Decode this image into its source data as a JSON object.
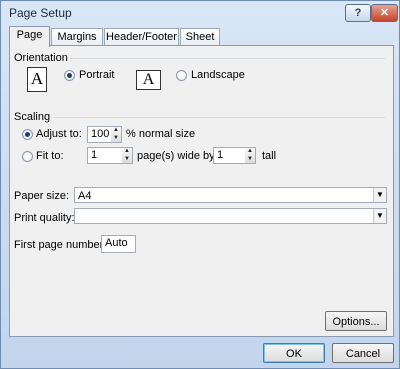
{
  "window": {
    "title": "Page Setup",
    "help_label": "?",
    "close_label": "✕"
  },
  "tabs": [
    {
      "label": "Page",
      "active": true
    },
    {
      "label": "Margins",
      "active": false
    },
    {
      "label": "Header/Footer",
      "active": false
    },
    {
      "label": "Sheet",
      "active": false
    }
  ],
  "orientation": {
    "heading": "Orientation",
    "portrait_label": "Portrait",
    "landscape_label": "Landscape",
    "selected": "portrait",
    "icon_glyph": "A"
  },
  "scaling": {
    "heading": "Scaling",
    "adjust_to_label": "Adjust to:",
    "adjust_to_value": "100",
    "normal_size_suffix": "% normal size",
    "fit_to_label": "Fit to:",
    "fit_pages_wide_value": "1",
    "pages_wide_suffix": "page(s) wide by",
    "fit_pages_tall_value": "1",
    "tall_suffix": "tall",
    "selected": "adjust_to"
  },
  "paper_size": {
    "label": "Paper size:",
    "value": "A4"
  },
  "print_quality": {
    "label": "Print quality:",
    "value": ""
  },
  "first_page_number": {
    "label": "First page number:",
    "value": "Auto"
  },
  "buttons": {
    "options": "Options...",
    "ok": "OK",
    "cancel": "Cancel"
  },
  "colors": {
    "accent": "#1f3f7f",
    "title_bar": "#c2d5ec",
    "close_button": "#c3452a"
  }
}
